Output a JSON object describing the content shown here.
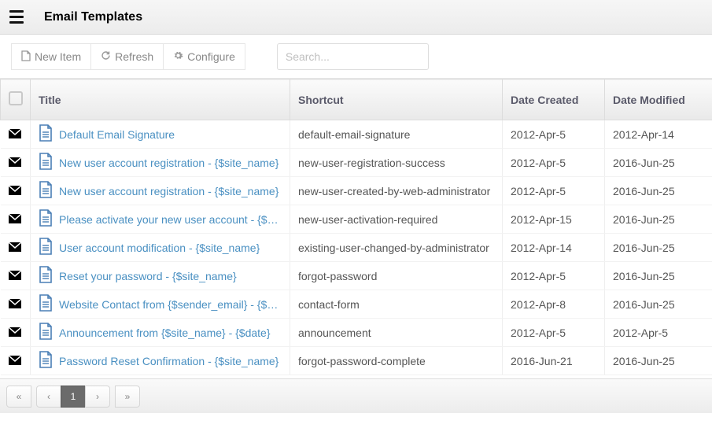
{
  "header": {
    "title": "Email Templates"
  },
  "toolbar": {
    "new_item": "New Item",
    "refresh": "Refresh",
    "configure": "Configure",
    "search_placeholder": "Search..."
  },
  "columns": {
    "title": "Title",
    "shortcut": "Shortcut",
    "date_created": "Date Created",
    "date_modified": "Date Modified"
  },
  "rows": [
    {
      "title": "Default Email Signature",
      "shortcut": "default-email-signature",
      "created": "2012-Apr-5",
      "modified": "2012-Apr-14"
    },
    {
      "title": "New user account registration - {$site_name}",
      "shortcut": "new-user-registration-success",
      "created": "2012-Apr-5",
      "modified": "2016-Jun-25"
    },
    {
      "title": "New user account registration - {$site_name}",
      "shortcut": "new-user-created-by-web-administrator",
      "created": "2012-Apr-5",
      "modified": "2016-Jun-25"
    },
    {
      "title": "Please activate your new user account - {$site_name}",
      "shortcut": "new-user-activation-required",
      "created": "2012-Apr-15",
      "modified": "2016-Jun-25"
    },
    {
      "title": "User account modification - {$site_name}",
      "shortcut": "existing-user-changed-by-administrator",
      "created": "2012-Apr-14",
      "modified": "2016-Jun-25"
    },
    {
      "title": "Reset your password - {$site_name}",
      "shortcut": "forgot-password",
      "created": "2012-Apr-5",
      "modified": "2016-Jun-25"
    },
    {
      "title": "Website Contact from {$sender_email} - {$date}",
      "shortcut": "contact-form",
      "created": "2012-Apr-8",
      "modified": "2016-Jun-25"
    },
    {
      "title": "Announcement from {$site_name} - {$date}",
      "shortcut": "announcement",
      "created": "2012-Apr-5",
      "modified": "2012-Apr-5"
    },
    {
      "title": "Password Reset Confirmation - {$site_name}",
      "shortcut": "forgot-password-complete",
      "created": "2016-Jun-21",
      "modified": "2016-Jun-25"
    }
  ],
  "pagination": {
    "first": "«",
    "prev": "‹",
    "page": "1",
    "next": "›",
    "last": "»"
  }
}
